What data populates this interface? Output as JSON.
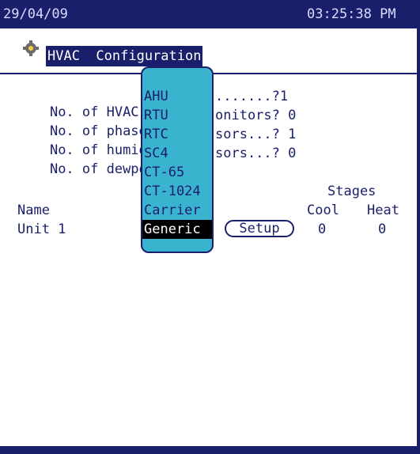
{
  "status": {
    "date": "29/04/09",
    "time": "03:25:38 PM"
  },
  "header": {
    "title": "HVAC  Configuration",
    "icon": "gear-icon"
  },
  "settings": {
    "rows": [
      {
        "label": "No. of HVAC ",
        "value": ".......?1"
      },
      {
        "label": "No. of phase",
        "value": "onitors? 0"
      },
      {
        "label": "No. of humid",
        "value": "sors...? 1"
      },
      {
        "label": "No. of dewpo",
        "value": "sors...? 0"
      }
    ]
  },
  "dropdown": {
    "options": [
      "AHU",
      "RTU",
      "RTC",
      "SC4",
      "CT-65",
      "CT-1024",
      "Carrier",
      "Generic"
    ],
    "selected": "Generic"
  },
  "table": {
    "stages_header": "Stages",
    "name_header": "Name",
    "cool_header": "Cool",
    "heat_header": "Heat",
    "unit_name": "Unit 1",
    "setup_label": "Setup",
    "cool_value": "0",
    "heat_value": "0"
  },
  "colors": {
    "navy": "#1a1f6b",
    "dropdown": "#3ab4ce"
  }
}
